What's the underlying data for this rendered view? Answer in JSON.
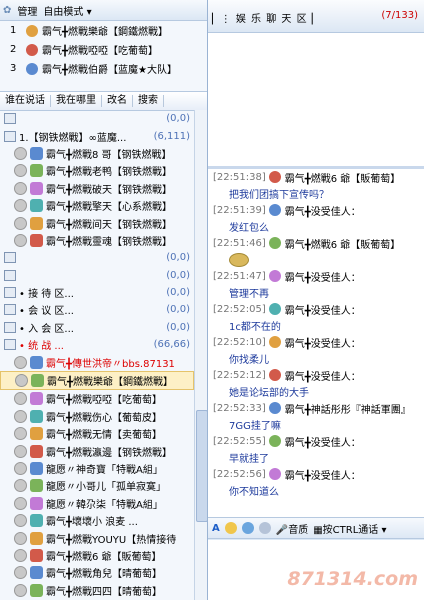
{
  "left_header": {
    "manage": "管理",
    "mode": "自由模式"
  },
  "rank_list": [
    {
      "num": "1",
      "name": "霸气╋燃戰樂爺【鋼鐵燃戰】"
    },
    {
      "num": "2",
      "name": "霸气╋燃戰啞啞【吃葡萄】"
    },
    {
      "num": "3",
      "name": "霸气╋燃戰伯爵【蓝魔★大队】"
    }
  ],
  "tabs": [
    "谁在说话",
    "我在哪里",
    "改名",
    "搜索"
  ],
  "tree_rows": [
    {
      "type": "grp",
      "label": "",
      "count": "(0,0)"
    },
    {
      "type": "grp",
      "label": "1.【钢铁燃戰】∞蓝魔...",
      "count": "(6,111)"
    },
    {
      "type": "mem",
      "label": "霸气╋燃戰8 哥【钢铁燃戰】"
    },
    {
      "type": "mem",
      "label": "霸气╋燃戰老鸭【钢铁燃戰】"
    },
    {
      "type": "mem",
      "label": "霸气╋燃戰破天【钢铁燃戰】"
    },
    {
      "type": "mem",
      "label": "霸气╋燃戰擎天【心系燃戰】"
    },
    {
      "type": "mem",
      "label": "霸气╋燃戰间天【钢铁燃戰】"
    },
    {
      "type": "mem",
      "label": "霸气╋燃戰靈魂【钢铁燃戰】"
    },
    {
      "type": "grp",
      "label": "",
      "count": "(0,0)"
    },
    {
      "type": "grp",
      "label": "",
      "count": "(0,0)"
    },
    {
      "type": "grp",
      "label": "• 接 待 区...",
      "count": "(0,0)"
    },
    {
      "type": "grp",
      "label": "• 会 议 区...",
      "count": "(0,0)"
    },
    {
      "type": "grp",
      "label": "• 入 会 区...",
      "count": "(0,0)"
    },
    {
      "type": "grp",
      "label": "• 统 战 ...",
      "count": "(66,66)",
      "red": true
    },
    {
      "type": "mem",
      "label": "霸气╋傳世洪帝〃bbs.87131",
      "red": true
    },
    {
      "type": "mem",
      "label": "霸气╋燃戰樂爺【鋼鐵燃戰】",
      "sel": true
    },
    {
      "type": "mem",
      "label": "霸气╋燃戰啞啞【吃葡萄】"
    },
    {
      "type": "mem",
      "label": "霸气╋燃戰伤心【葡萄皮】"
    },
    {
      "type": "mem",
      "label": "霸气╋燃戰无情【卖葡萄】"
    },
    {
      "type": "mem",
      "label": "霸气╋燃戰瀛邊【钢铁燃戰】"
    },
    {
      "type": "mem",
      "label": "龍愿〃神奇寶「特戰A組」"
    },
    {
      "type": "mem",
      "label": "龍愿〃小哥儿「孤单寂寞」"
    },
    {
      "type": "mem",
      "label": "龍愿〃韓尕柒「特戰A組」"
    },
    {
      "type": "mem",
      "label": "霸气╋壞壞小  浪麦 ..."
    },
    {
      "type": "mem",
      "label": "霸气╋燃戰YOUYU【热情接待"
    },
    {
      "type": "mem",
      "label": "霸气╋燃戰6 爺【販葡萄】"
    },
    {
      "type": "mem",
      "label": "霸气╋燃戰角兒【晴葡萄】"
    },
    {
      "type": "mem",
      "label": "霸气╋燃戰四四【晴葡萄】"
    },
    {
      "type": "mem",
      "label": "霸气╋燃戰中国【蓝魔★大"
    }
  ],
  "room": {
    "title": "娱 乐 聊 天 区",
    "count": "(7/133)"
  },
  "chat": [
    {
      "time": "[22:51:38]",
      "user": "霸气╋燃戰6 爺【販葡萄】",
      "text": "把我们团搞下宣传吗？"
    },
    {
      "time": "[22:51:39]",
      "user": "霸气╋没受佳人：",
      "text": "发红包么"
    },
    {
      "time": "[22:51:46]",
      "user": "霸气╋燃戰6 爺【販葡萄】",
      "text": "",
      "sticker": true
    },
    {
      "time": "[22:51:47]",
      "user": "霸气╋没受佳人：",
      "text": "管理不再"
    },
    {
      "time": "[22:52:05]",
      "user": "霸气╋没受佳人：",
      "text": "1c都不在的"
    },
    {
      "time": "[22:52:10]",
      "user": "霸气╋没受佳人：",
      "text": "你找柔儿"
    },
    {
      "time": "[22:52:12]",
      "user": "霸气╋没受佳人：",
      "text": "她是论坛部的大手"
    },
    {
      "time": "[22:52:33]",
      "user": "霸气╋神話彤彤『神話軍團』",
      "text": "7GG挂了嘛"
    },
    {
      "time": "[22:52:55]",
      "user": "霸气╋没受佳人：",
      "text": "早就挂了"
    },
    {
      "time": "[22:52:56]",
      "user": "霸气╋没受佳人：",
      "text": "你不知道么"
    }
  ],
  "toolbar": {
    "voice": "音质",
    "send_mode": "按CTRL通话"
  },
  "watermark": "871314.com"
}
